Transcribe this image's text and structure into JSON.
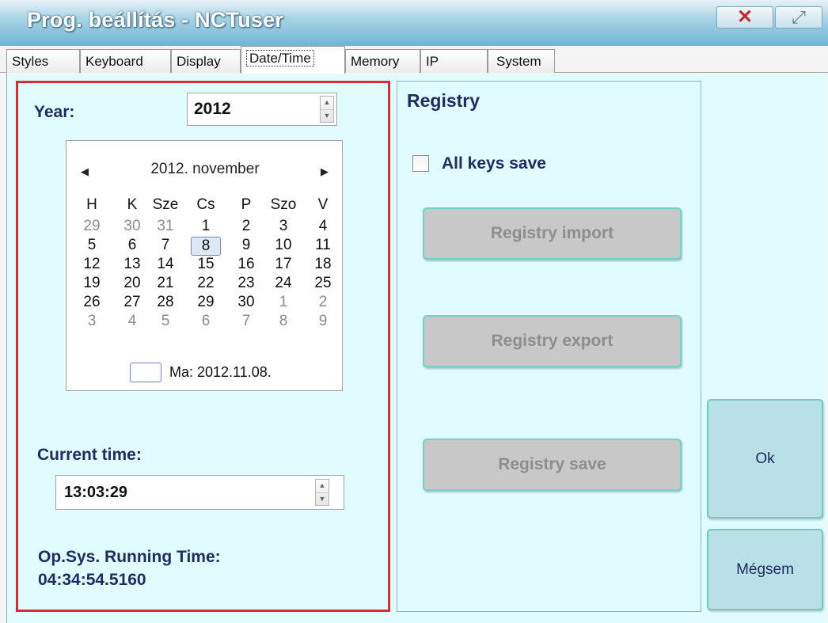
{
  "window": {
    "title": "Prog. beállítás - NCTuser",
    "close_glyph": "✕",
    "maximize_glyph": "⤢"
  },
  "tabs": [
    {
      "label": "Styles"
    },
    {
      "label": "Keyboard"
    },
    {
      "label": "Display"
    },
    {
      "label": "Date/Time",
      "active": true
    },
    {
      "label": "Memory"
    },
    {
      "label": "IP"
    },
    {
      "label": "System"
    }
  ],
  "date_panel": {
    "year_label": "Year:",
    "year_value": "2012",
    "calendar": {
      "prev_glyph": "◀",
      "next_glyph": "▶",
      "title": "2012. november",
      "day_names": [
        "H",
        "K",
        "Sze",
        "Cs",
        "P",
        "Szo",
        "V"
      ],
      "weeks": [
        [
          "29",
          "30",
          "31",
          "1",
          "2",
          "3",
          "4"
        ],
        [
          "5",
          "6",
          "7",
          "8",
          "9",
          "10",
          "11"
        ],
        [
          "12",
          "13",
          "14",
          "15",
          "16",
          "17",
          "18"
        ],
        [
          "19",
          "20",
          "21",
          "22",
          "23",
          "24",
          "25"
        ],
        [
          "26",
          "27",
          "28",
          "29",
          "30",
          "1",
          "2"
        ],
        [
          "3",
          "4",
          "5",
          "6",
          "7",
          "8",
          "9"
        ]
      ],
      "selected_day": "8",
      "today_text": "Ma: 2012.11.08."
    },
    "current_time_label": "Current time:",
    "current_time_value": "13:03:29",
    "running_time_label": "Op.Sys. Running Time:",
    "running_time_value": "04:34:54.5160"
  },
  "registry": {
    "title": "Registry",
    "all_keys_save_label": "All keys save",
    "all_keys_save_checked": false,
    "import_label": "Registry import",
    "export_label": "Registry export",
    "save_label": "Registry save"
  },
  "buttons": {
    "ok_label": "Ok",
    "cancel_label": "Mégsem"
  },
  "colors": {
    "highlight_border": "#d72b36",
    "panel_background": "#e0fcff",
    "label_text": "#1f2c62",
    "button_accent": "#6ecdbf"
  }
}
